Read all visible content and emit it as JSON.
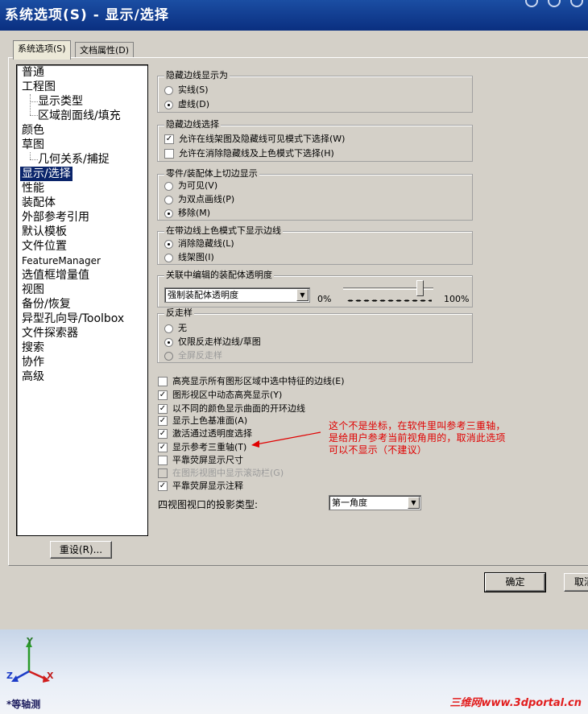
{
  "window": {
    "title": "系统选项(S) - 显示/选择"
  },
  "tabs": [
    {
      "label": "系统选项(S)",
      "active": true
    },
    {
      "label": "文档属性(D)",
      "active": false
    }
  ],
  "tree": {
    "items": [
      {
        "label": "普通"
      },
      {
        "label": "工程图"
      },
      {
        "label": "显示类型"
      },
      {
        "label": "区域剖面线/填充"
      },
      {
        "label": "颜色"
      },
      {
        "label": "草图"
      },
      {
        "label": "几何关系/捕捉"
      },
      {
        "label": "显示/选择",
        "selected": true
      },
      {
        "label": "性能"
      },
      {
        "label": "装配体"
      },
      {
        "label": "外部参考引用"
      },
      {
        "label": "默认模板"
      },
      {
        "label": "文件位置"
      },
      {
        "label": "FeatureManager"
      },
      {
        "label": "选值框增量值"
      },
      {
        "label": "视图"
      },
      {
        "label": "备份/恢复"
      },
      {
        "label": "异型孔向导/Toolbox"
      },
      {
        "label": "文件探索器"
      },
      {
        "label": "搜索"
      },
      {
        "label": "协作"
      },
      {
        "label": "高级"
      }
    ]
  },
  "reset_button": "重设(R)...",
  "groups": {
    "hidden_edges_display": {
      "title": "隐藏边线显示为",
      "options": [
        {
          "label": "实线(S)",
          "checked": false
        },
        {
          "label": "虚线(D)",
          "checked": true
        }
      ]
    },
    "hidden_edges_select": {
      "title": "隐藏边线选择",
      "options": [
        {
          "label": "允许在线架图及隐藏线可见模式下选择(W)",
          "checked": true
        },
        {
          "label": "允许在消除隐藏线及上色模式下选择(H)",
          "checked": false
        }
      ]
    },
    "tangent_edges": {
      "title": "零件/装配体上切边显示",
      "options": [
        {
          "label": "为可见(V)",
          "checked": false
        },
        {
          "label": "为双点画线(P)",
          "checked": false
        },
        {
          "label": "移除(M)",
          "checked": true
        }
      ]
    },
    "shaded_edges": {
      "title": "在带边线上色模式下显示边线",
      "options": [
        {
          "label": "消除隐藏线(L)",
          "checked": true
        },
        {
          "label": "线架图(I)",
          "checked": false
        }
      ]
    },
    "assembly_transparency": {
      "title": "关联中编辑的装配体透明度",
      "select_value": "强制装配体透明度",
      "min_label": "0%",
      "max_label": "100%",
      "slider_value": 0.85
    },
    "antialiasing": {
      "title": "反走样",
      "options": [
        {
          "label": "无",
          "checked": false,
          "disabled": false
        },
        {
          "label": "仅限反走样边线/草图",
          "checked": true,
          "disabled": false
        },
        {
          "label": "全屏反走样",
          "checked": false,
          "disabled": true
        }
      ]
    }
  },
  "checkboxes": [
    {
      "label": "高亮显示所有图形区域中选中特征的边线(E)",
      "checked": false,
      "disabled": false
    },
    {
      "label": "图形视区中动态高亮显示(Y)",
      "checked": true,
      "disabled": false
    },
    {
      "label": "以不同的颜色显示曲面的开环边线",
      "checked": true,
      "disabled": false
    },
    {
      "label": "显示上色基准面(A)",
      "checked": true,
      "disabled": false
    },
    {
      "label": "激活通过透明度选择",
      "checked": true,
      "disabled": false
    },
    {
      "label": "显示参考三重轴(T)",
      "checked": true,
      "disabled": false
    },
    {
      "label": "平靠荧屏显示尺寸",
      "checked": false,
      "disabled": false
    },
    {
      "label": "在图形视图中显示滚动栏(G)",
      "checked": false,
      "disabled": true
    },
    {
      "label": "平靠荧屏显示注释",
      "checked": true,
      "disabled": false
    }
  ],
  "projection": {
    "label": "四视图视口的投影类型:",
    "value": "第一角度"
  },
  "ok_button": "确定",
  "cancel_button": "取消",
  "annotation": "这个不是坐标，在软件里叫参考三重轴，\n是给用户参考当前视角用的，取消此选项\n可以不显示（不建议）",
  "triad": {
    "x": "X",
    "y": "Y",
    "z": "Z"
  },
  "view_label": "*等轴测",
  "watermark": "三维网www.3dportal.cn",
  "colors": {
    "title_bar": "#0a2f80",
    "annotation": "#e00000",
    "selection": "#0a246a"
  }
}
